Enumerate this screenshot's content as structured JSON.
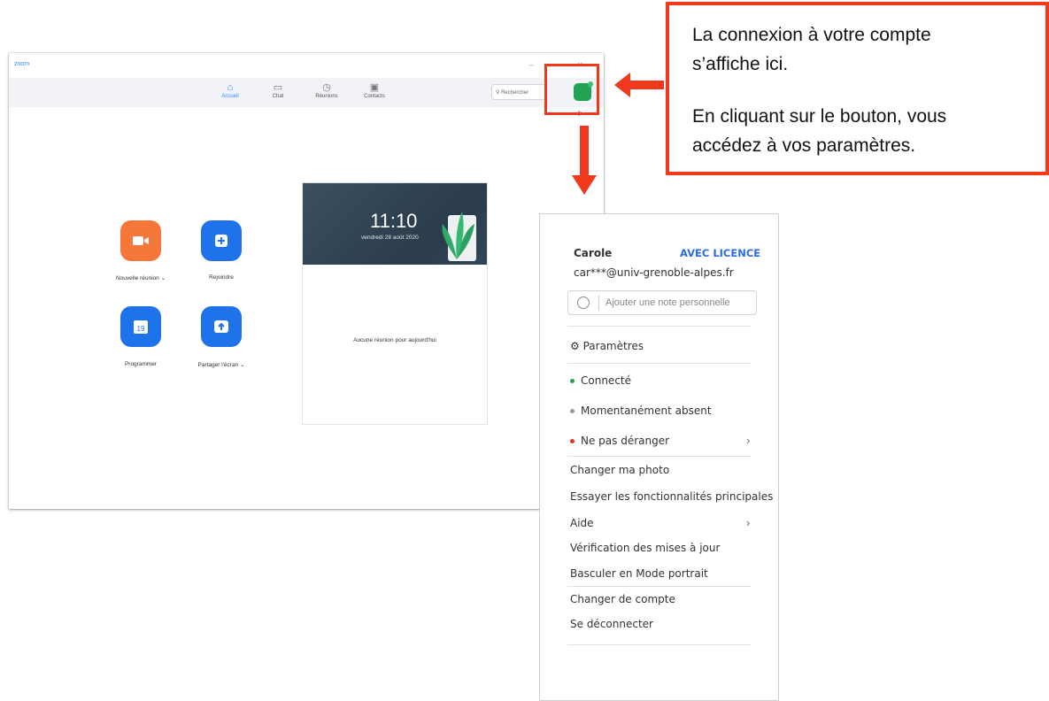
{
  "zoom": {
    "app_title": "zoom",
    "nav": [
      {
        "label": "Accueil"
      },
      {
        "label": "Chat"
      },
      {
        "label": "Réunions"
      },
      {
        "label": "Contacts"
      }
    ],
    "search_placeholder": "Rechercher",
    "actions": [
      {
        "label": "Nouvelle réunion"
      },
      {
        "label": "Rejoindre"
      },
      {
        "label": "Programmer"
      },
      {
        "label": "Partager l'écran"
      }
    ],
    "calendar": {
      "time": "11:10",
      "date": "vendredi 28 août 2020",
      "empty": "Aucune réunion pour aujourd'hui",
      "day_number": "19"
    }
  },
  "annotation": {
    "line1": "La connexion à votre compte",
    "line2": "s’affiche ici.",
    "line3": "En cliquant sur le bouton, vous",
    "line4": "accédez à vos paramètres."
  },
  "menu": {
    "name": "Carole",
    "license": "AVEC LICENCE",
    "email": "car***@univ-grenoble-alpes.fr",
    "note_placeholder": "Ajouter une note personnelle",
    "settings": "Paramètres",
    "status_connected": "Connecté",
    "status_away": "Momentanément absent",
    "status_dnd": "Ne pas déranger",
    "change_photo": "Changer ma photo",
    "try_features": "Essayer les fonctionnalités principales",
    "help": "Aide",
    "check_updates": "Vérification des mises à jour",
    "portrait_mode": "Basculer en Mode portrait",
    "switch_account": "Changer de compte",
    "sign_out": "Se déconnecter"
  },
  "colors": {
    "accent": "#2d8cff",
    "highlight": "#f0381c",
    "orange_button": "#f6773a",
    "blue_button": "#1f73ea",
    "status_green": "#23a454",
    "status_red": "#e0342c"
  }
}
